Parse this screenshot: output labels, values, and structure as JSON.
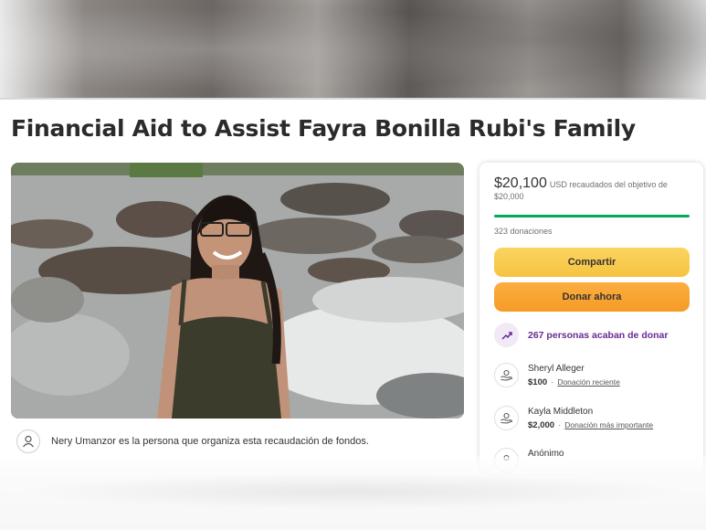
{
  "page": {
    "title": "Financial Aid to Assist Fayra Bonilla Rubi's Family"
  },
  "organizer": {
    "text": "Nery Umanzor es la persona que organiza esta recaudación de fondos.",
    "icon": "person-icon"
  },
  "donation_card": {
    "amount_raised": "$20,100",
    "raised_label": "USD recaudados del objetivo de $20,000",
    "progress_fraction": 1.0,
    "donation_count": "323 donaciones",
    "share_label": "Compartir",
    "donate_label": "Donar ahora",
    "recent_activity": "267 personas acaban de donar",
    "colors": {
      "progress": "#02a95c",
      "share_button": "#f7c945",
      "donate_button": "#f6a22e",
      "recent_text": "#6a2a92"
    },
    "donors": [
      {
        "name": "Sheryl Alleger",
        "amount": "$100",
        "tag": "Donación reciente"
      },
      {
        "name": "Kayla Middleton",
        "amount": "$2,000",
        "tag": "Donación más importante"
      },
      {
        "name": "Anónimo"
      }
    ]
  }
}
